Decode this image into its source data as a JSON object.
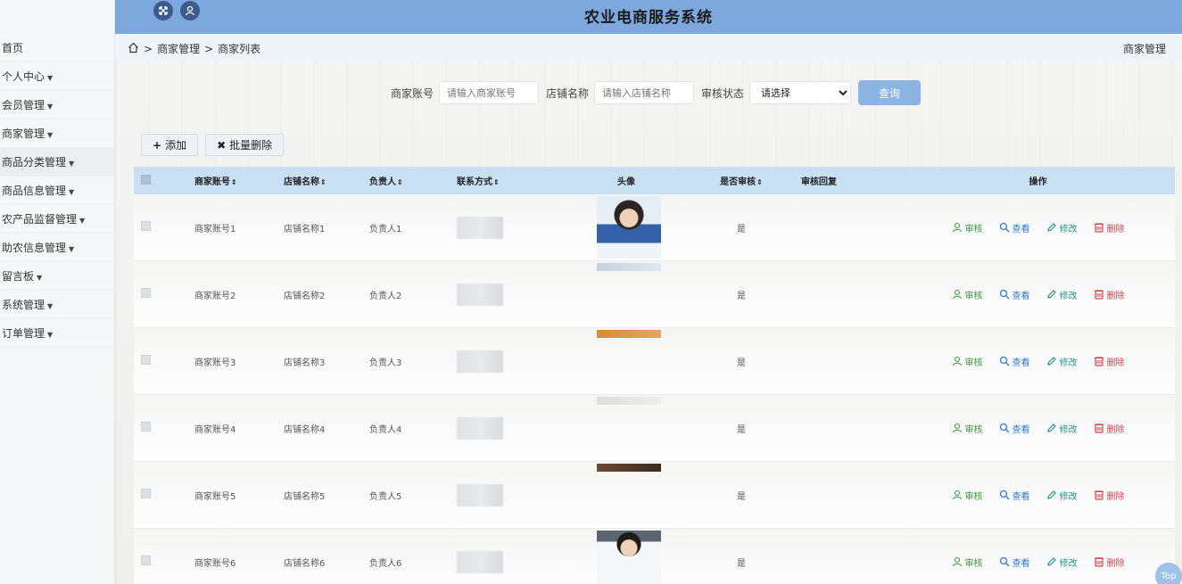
{
  "header": {
    "title": "农业电商服务系统",
    "icons": [
      "fullscreen-icon",
      "user-icon"
    ]
  },
  "sidebar": {
    "items": [
      {
        "label": "首页",
        "has_caret": false
      },
      {
        "label": "个人中心",
        "has_caret": true
      },
      {
        "label": "会员管理",
        "has_caret": true
      },
      {
        "label": "商家管理",
        "has_caret": true
      },
      {
        "label": "商品分类管理",
        "has_caret": true
      },
      {
        "label": "商品信息管理",
        "has_caret": true
      },
      {
        "label": "农产品监督管理",
        "has_caret": true
      },
      {
        "label": "助农信息管理",
        "has_caret": true
      },
      {
        "label": "留言板",
        "has_caret": true
      },
      {
        "label": "系统管理",
        "has_caret": true
      },
      {
        "label": "订单管理",
        "has_caret": true
      }
    ]
  },
  "breadcrumb": {
    "items": [
      "商家管理",
      "商家列表"
    ],
    "separator": ">",
    "right_label": "商家管理"
  },
  "search": {
    "account_label": "商家账号",
    "account_placeholder": "请输入商家账号",
    "shop_label": "店铺名称",
    "shop_placeholder": "请输入店铺名称",
    "status_label": "审核状态",
    "status_value": "请选择",
    "query_button": "查询"
  },
  "toolbar": {
    "add_label": "添加",
    "batch_delete_label": "批量删除"
  },
  "table": {
    "headers": {
      "account": "商家账号",
      "shop": "店铺名称",
      "owner": "负责人",
      "phone": "联系方式",
      "avatar": "头像",
      "audited": "是否审核",
      "reply": "审核回复",
      "ops": "操作"
    },
    "sort_glyph": "⇕",
    "rows": [
      {
        "account": "商家账号1",
        "shop": "店铺名称1",
        "owner": "负责人1",
        "audited": "是",
        "reply": ""
      },
      {
        "account": "商家账号2",
        "shop": "店铺名称2",
        "owner": "负责人2",
        "audited": "是",
        "reply": ""
      },
      {
        "account": "商家账号3",
        "shop": "店铺名称3",
        "owner": "负责人3",
        "audited": "是",
        "reply": ""
      },
      {
        "account": "商家账号4",
        "shop": "店铺名称4",
        "owner": "负责人4",
        "audited": "是",
        "reply": ""
      },
      {
        "account": "商家账号5",
        "shop": "店铺名称5",
        "owner": "负责人5",
        "audited": "是",
        "reply": ""
      },
      {
        "account": "商家账号6",
        "shop": "店铺名称6",
        "owner": "负责人6",
        "audited": "是",
        "reply": ""
      }
    ],
    "ops": {
      "audit": "审核",
      "view": "查看",
      "edit": "修改",
      "delete": "删除"
    }
  },
  "colors": {
    "header_bg": "#7ca8dd",
    "table_header_bg": "#c8dff4",
    "audit": "#3a9a3a",
    "view": "#2f7ad1",
    "edit": "#23958d",
    "delete": "#d7424a"
  },
  "top_button": "Top"
}
